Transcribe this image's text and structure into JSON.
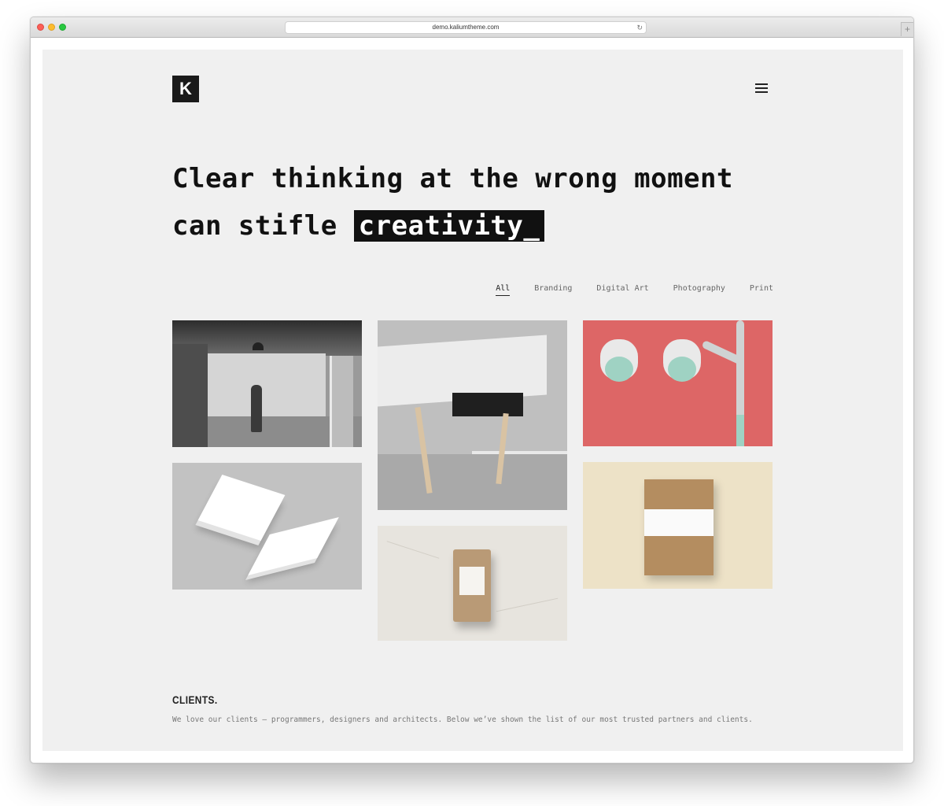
{
  "browser": {
    "url": "demo.kaliumtheme.com",
    "reload_icon": "reload-icon",
    "newtab_symbol": "+"
  },
  "header": {
    "logo_letter": "K",
    "menu_icon": "hamburger-menu-icon"
  },
  "hero": {
    "text": "Clear thinking at the wrong moment can stifle ",
    "highlight": "creativity_"
  },
  "filters": [
    {
      "label": "All",
      "active": true
    },
    {
      "label": "Branding",
      "active": false
    },
    {
      "label": "Digital Art",
      "active": false
    },
    {
      "label": "Photography",
      "active": false
    },
    {
      "label": "Print",
      "active": false
    }
  ],
  "portfolio": [
    {
      "id": "studio-photo"
    },
    {
      "id": "desk-photo"
    },
    {
      "id": "lamp-photo"
    },
    {
      "id": "business-cards-photo"
    },
    {
      "id": "coffee-bag-photo"
    },
    {
      "id": "notebook-photo"
    }
  ],
  "clients": {
    "title": "CLIENTS.",
    "description": "We love our clients – programmers, designers and architects. Below we’ve shown the list of our most trusted partners and clients."
  },
  "colors": {
    "page_background": "#f0f0f0",
    "text_dark": "#111111",
    "highlight_bg": "#111111",
    "lamp_tile": "#dd6666"
  }
}
